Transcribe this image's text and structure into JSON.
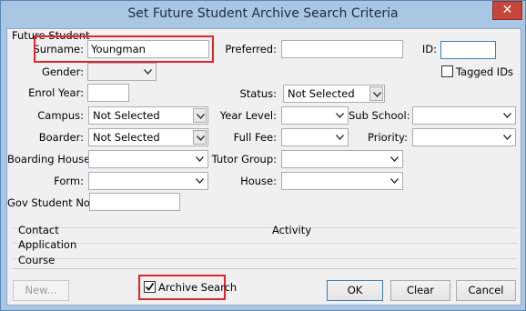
{
  "window": {
    "title": "Set Future Student Archive Search Criteria",
    "close_glyph": "✕"
  },
  "group": {
    "label": "Future Student"
  },
  "fields": {
    "surname": {
      "label": "Surname:",
      "value": "Youngman"
    },
    "preferred": {
      "label": "Preferred:",
      "value": ""
    },
    "id": {
      "label": "ID:",
      "value": ""
    },
    "tagged_ids": {
      "label": "Tagged IDs",
      "checked": false
    },
    "gender": {
      "label": "Gender:",
      "value": ""
    },
    "enrol_year": {
      "label": "Enrol Year:",
      "value": ""
    },
    "status": {
      "label": "Status:",
      "value": "Not Selected"
    },
    "campus": {
      "label": "Campus:",
      "value": "Not Selected"
    },
    "year_level": {
      "label": "Year Level:",
      "value": ""
    },
    "sub_school": {
      "label": "Sub School:",
      "value": ""
    },
    "boarder": {
      "label": "Boarder:",
      "value": "Not Selected"
    },
    "full_fee": {
      "label": "Full Fee:",
      "value": ""
    },
    "priority": {
      "label": "Priority:",
      "value": ""
    },
    "boarding_house": {
      "label": "Boarding House:",
      "value": ""
    },
    "tutor_group": {
      "label": "Tutor Group:",
      "value": ""
    },
    "form": {
      "label": "Form:",
      "value": ""
    },
    "house": {
      "label": "House:",
      "value": ""
    },
    "gov_student_no": {
      "label": "Gov Student No:",
      "value": ""
    }
  },
  "sections": {
    "contact": "Contact",
    "activity": "Activity",
    "application": "Application",
    "course": "Course"
  },
  "footer": {
    "new_button": "New...",
    "archive_search": {
      "label": "Archive Search",
      "checked": true
    },
    "ok_button": "OK",
    "clear_button": "Clear",
    "cancel_button": "Cancel"
  },
  "colors": {
    "highlight": "#e0262b",
    "title_bar": "#a9c6e2",
    "close_button": "#c7463b"
  }
}
